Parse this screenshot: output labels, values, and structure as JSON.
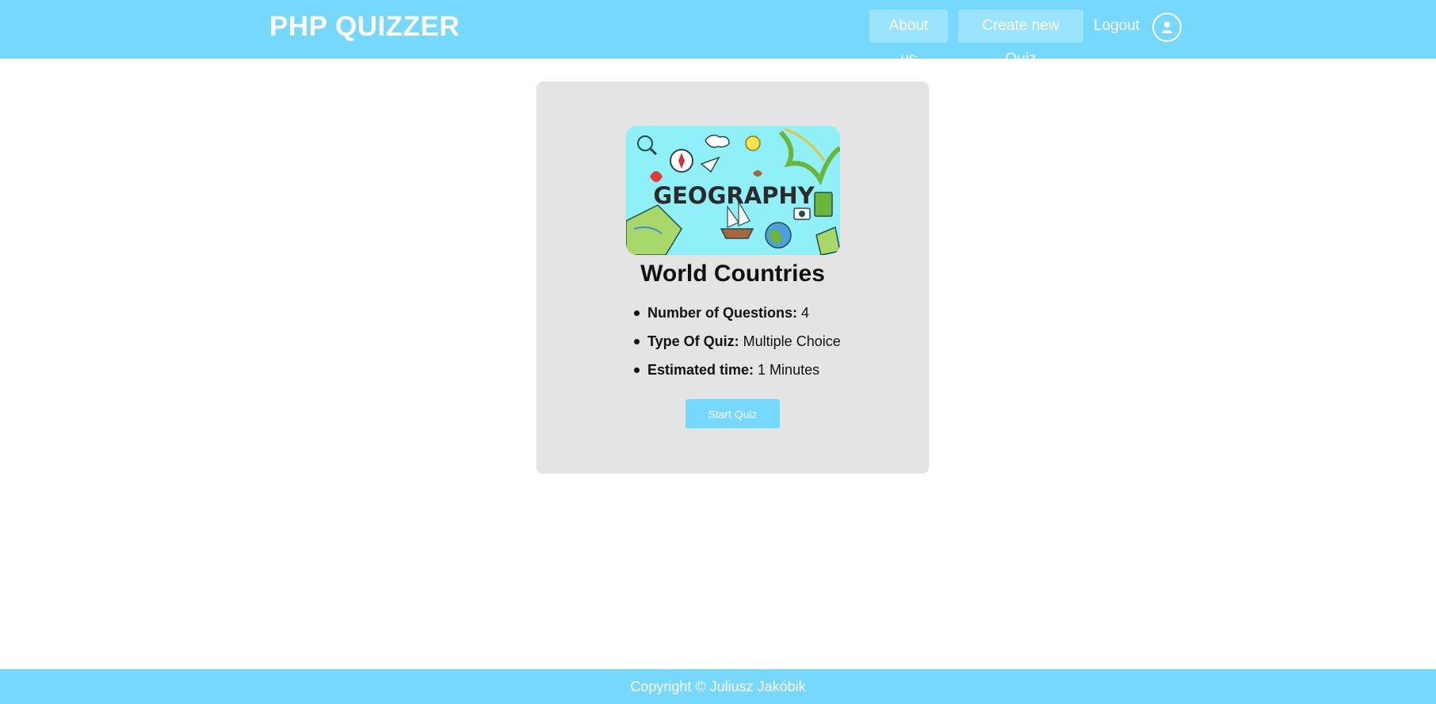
{
  "header": {
    "brand": "PHP QUIZZER",
    "nav": {
      "about": "About us",
      "create": "Create new Quiz",
      "logout": "Logout"
    },
    "avatar_icon": "user-circle-icon",
    "background_color": "#76d8fd"
  },
  "quiz": {
    "image_text": "GEOGRAPHY",
    "title": "World Countries",
    "details": [
      {
        "label": "Number of Questions:",
        "value": "4"
      },
      {
        "label": "Type Of Quiz:",
        "value": "Multiple Choice"
      },
      {
        "label": "Estimated time:",
        "value": "1 Minutes"
      }
    ],
    "start_label": "Start Quiz",
    "card_color": "#e4e4e4"
  },
  "footer": {
    "text": "Copyright © Juliusz Jakóbik"
  }
}
